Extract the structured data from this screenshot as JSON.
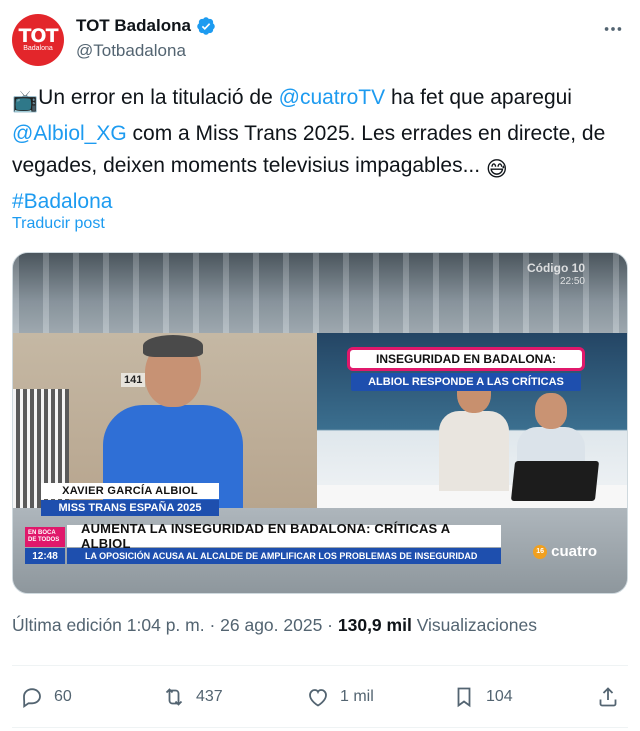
{
  "author": {
    "display_name": "TOT Badalona",
    "handle": "@Totbadalona",
    "avatar_text": "TOT",
    "avatar_subtext": "Badalona"
  },
  "tweet": {
    "part1": "Un error en la titulació de ",
    "mention1": "@cuatroTV",
    "part2": " ha fet que aparegui ",
    "mention2": "@Albiol_XG",
    "part3": " com a Miss Trans 2025. Les errades en directe, de vegades, deixen moments televisius impagables... ",
    "hashtag": "#Badalona",
    "tv_emoji": "📺",
    "sweat_emoji": "😅"
  },
  "translate_label": "Traducir post",
  "media": {
    "watermark": "Código 10",
    "watermark_time": "22:50",
    "house_number": "141",
    "chyron_top": "INSEGURIDAD EN BADALONA:",
    "chyron_sub": "ALBIOL RESPONDE A LAS CRÍTICAS",
    "name_plate": "XAVIER GARCÍA ALBIOL",
    "title_plate": "MISS TRANS ESPAÑA 2025",
    "ticker_main": "AUMENTA LA INSEGURIDAD EN BADALONA: CRÍTICAS A ALBIOL",
    "ticker_sub": "LA OPOSICIÓN ACUSA AL ALCALDE DE AMPLIFICAR LOS PROBLEMAS DE INSEGURIDAD",
    "en_boca": "EN BOCA DE TODOS",
    "clock": "12:48",
    "channel": "cuatro",
    "rating": "16"
  },
  "meta": {
    "edited": "Última edición 1:04 p. m. · 26 ago. 2025 · ",
    "views_count": "130,9 mil",
    "views_label": " Visualizaciones"
  },
  "actions": {
    "replies": "60",
    "reposts": "437",
    "likes": "1 mil",
    "bookmarks": "104"
  },
  "colors": {
    "link": "#1d9bf0",
    "muted": "#536471",
    "brand_red": "#e3262b",
    "tv_blue": "#1e4fae",
    "tv_pink": "#e0186b"
  }
}
